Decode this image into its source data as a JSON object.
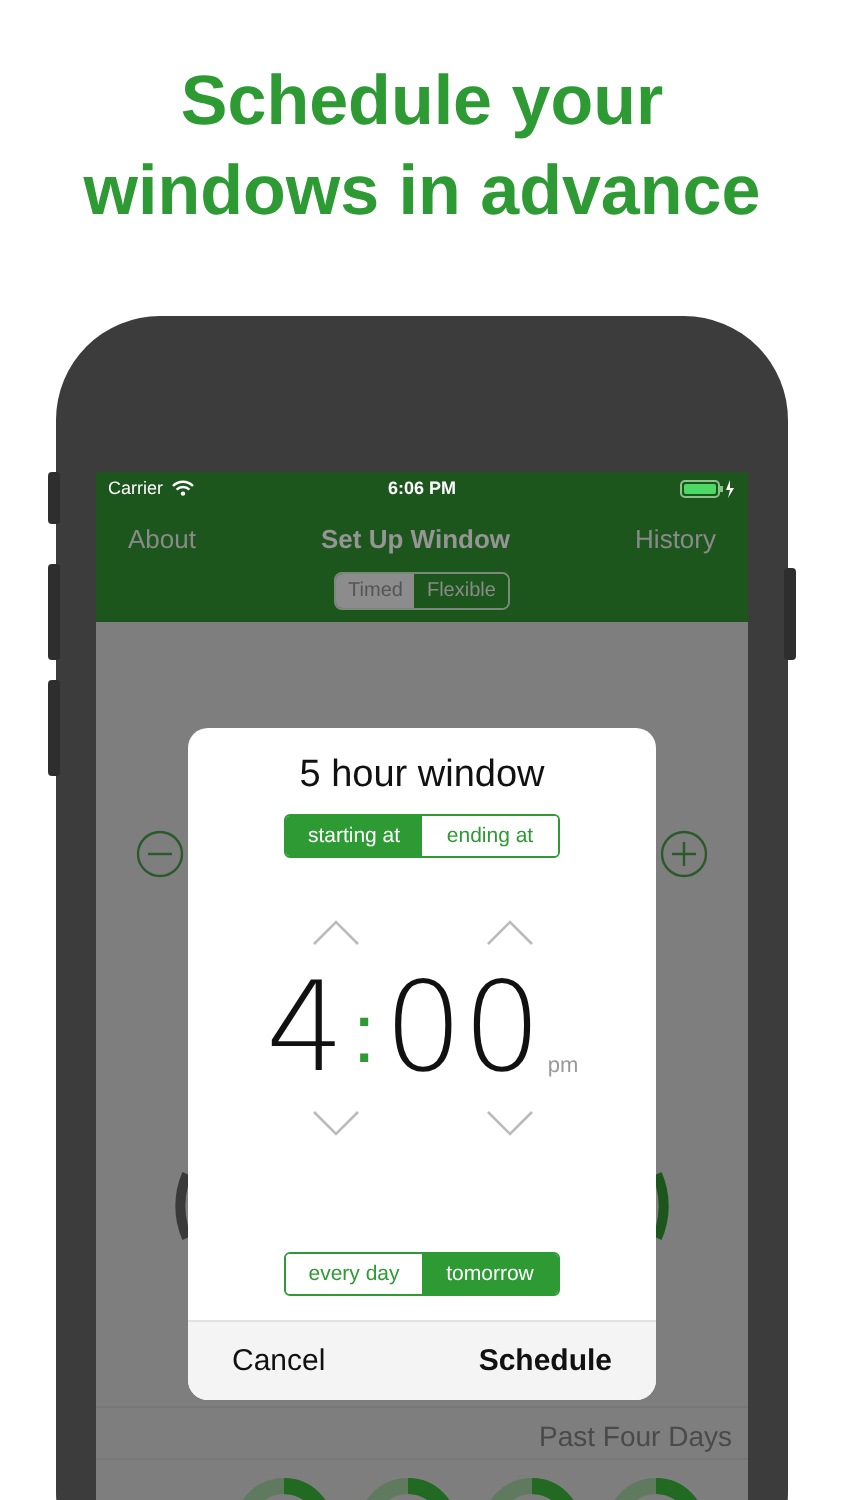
{
  "headline": "Schedule your windows in advance",
  "status_bar": {
    "carrier": "Carrier",
    "time": "6:06 PM"
  },
  "nav": {
    "left": "About",
    "title": "Set Up Window",
    "right": "History"
  },
  "mode_tabs": [
    {
      "label": "Timed",
      "selected": true
    },
    {
      "label": "Flexible",
      "selected": false
    }
  ],
  "dialog": {
    "title": "5 hour window",
    "start_mode": [
      {
        "label": "starting at",
        "selected": true
      },
      {
        "label": "ending at",
        "selected": false
      }
    ],
    "time": {
      "hour": "4",
      "separator": ":",
      "minutes": "00",
      "meridiem": "pm"
    },
    "repeat": [
      {
        "label": "every day",
        "selected": false
      },
      {
        "label": "tomorrow",
        "selected": true
      }
    ],
    "cancel": "Cancel",
    "confirm": "Schedule"
  },
  "history": {
    "title": "Past Four Days",
    "rings": [
      {
        "kind": "ring"
      },
      {
        "kind": "ring"
      },
      {
        "kind": "ring"
      },
      {
        "kind": "ring"
      }
    ]
  }
}
